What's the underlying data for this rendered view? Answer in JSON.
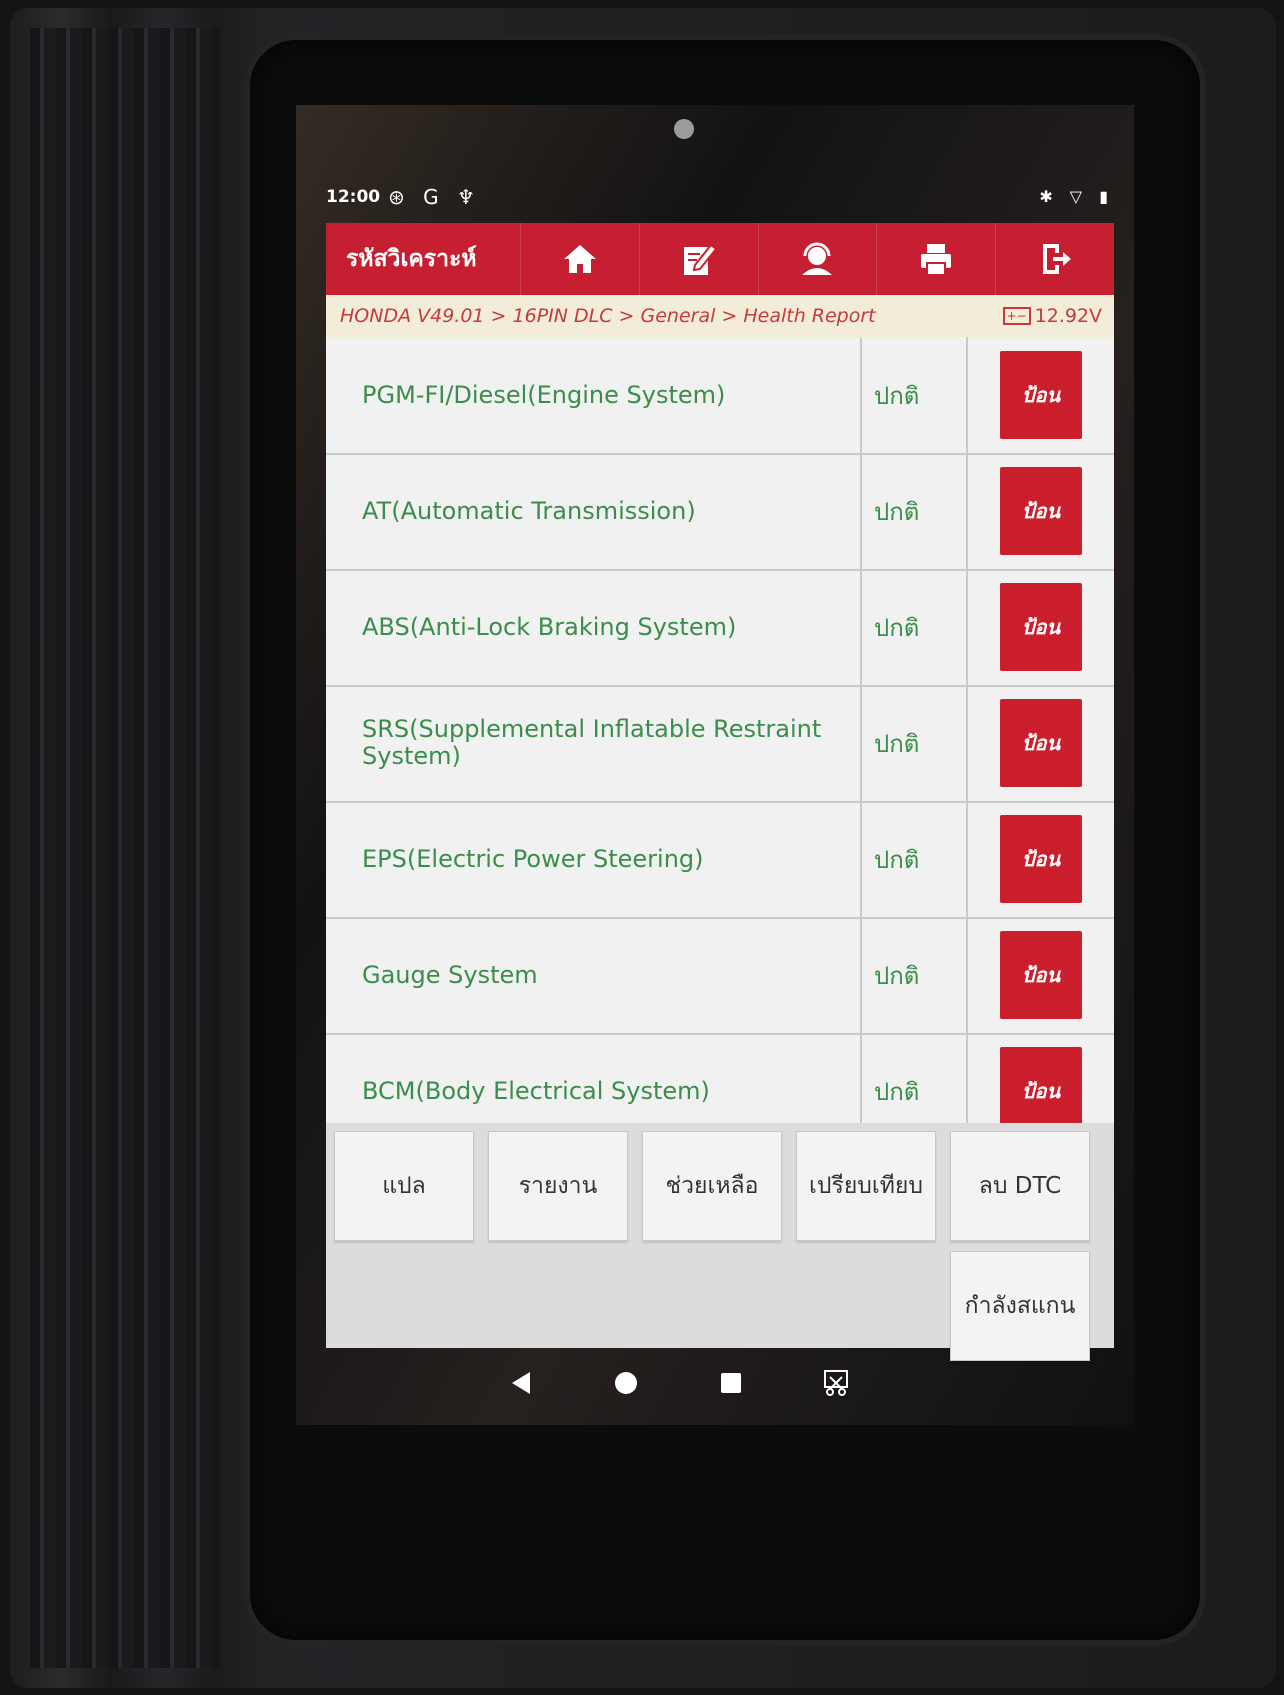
{
  "status_bar": {
    "time": "12:00",
    "left_icons": "⊛ G ♆",
    "right_icons": "✱ ▽ ▮"
  },
  "app": {
    "title": "รหัสวิเคราะห์",
    "toolbar_icons": [
      "home-icon",
      "edit-icon",
      "support-icon",
      "print-icon",
      "exit-icon"
    ],
    "accent_color": "#c61f32"
  },
  "breadcrumb": {
    "path": "HONDA V49.01 > 16PIN DLC > General > Health Report",
    "battery_voltage": "12.92V"
  },
  "systems": [
    {
      "name": "PGM-FI/Diesel(Engine System)",
      "status": "ปกติ",
      "button": "ป้อน"
    },
    {
      "name": "AT(Automatic Transmission)",
      "status": "ปกติ",
      "button": "ป้อน"
    },
    {
      "name": "ABS(Anti-Lock Braking System)",
      "status": "ปกติ",
      "button": "ป้อน"
    },
    {
      "name": "SRS(Supplemental Inflatable Restraint System)",
      "status": "ปกติ",
      "button": "ป้อน"
    },
    {
      "name": "EPS(Electric Power Steering)",
      "status": "ปกติ",
      "button": "ป้อน"
    },
    {
      "name": "Gauge System",
      "status": "ปกติ",
      "button": "ป้อน"
    },
    {
      "name": "BCM(Body Electrical System)",
      "status": "ปกติ",
      "button": "ป้อน"
    }
  ],
  "actions": {
    "translate": "แปล",
    "report": "รายงาน",
    "help": "ช่วยเหลือ",
    "compare": "เปรียบเทียบ",
    "clear_dtc": "ลบ DTC",
    "scanning": "กำลังสแกน"
  },
  "nav_icons": [
    "back-icon",
    "home-circle-icon",
    "recents-icon",
    "screenshot-icon"
  ]
}
